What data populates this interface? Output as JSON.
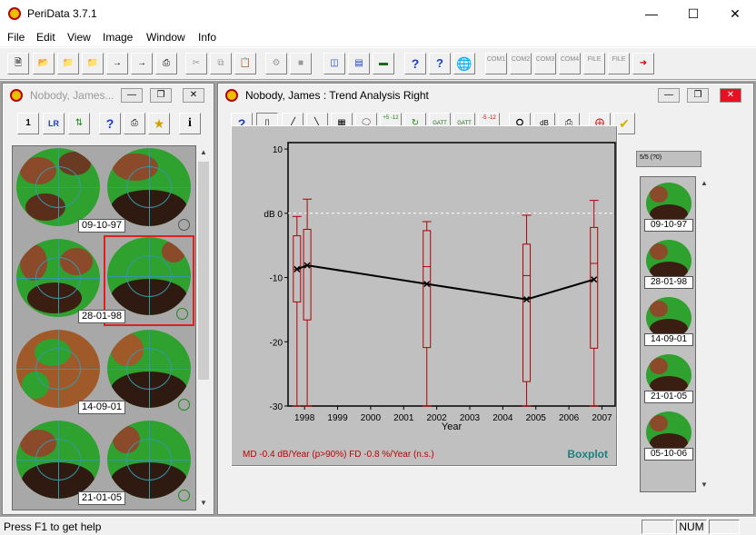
{
  "app": {
    "title": "PeriData 3.7.1"
  },
  "menu": [
    "File",
    "Edit",
    "View",
    "Image",
    "Window",
    "Info"
  ],
  "toolbar": {
    "com_labels": [
      "COM1",
      "COM2",
      "COM3",
      "COM4",
      "FILE",
      "FILE"
    ],
    "help_glyph": "?",
    "whatsthis_glyph": "?"
  },
  "left_window": {
    "title": "Nobody, James...",
    "toolbar_labels": {
      "one": "1",
      "lr": "LR",
      "help": "?",
      "info": "i"
    },
    "thumbs": [
      {
        "date": "09-10-97"
      },
      {
        "date": "28-01-98"
      },
      {
        "date": "14-09-01"
      },
      {
        "date": "21-01-05"
      }
    ]
  },
  "right_window": {
    "title": "Nobody, James  :  Trend Analysis  Right",
    "counter": "5/5 (?0)",
    "toolbar_labels": {
      "help": "?",
      "plus_minus": "+5 -12",
      "minus_plus": "-5 -12",
      "gatt": "GATT",
      "db": "dB"
    },
    "thumbs": [
      "09-10-97",
      "28-01-98",
      "14-09-01",
      "21-01-05",
      "05-10-06"
    ]
  },
  "chart_data": {
    "type": "boxplot",
    "xlabel": "Year",
    "ylabel": "dB 0",
    "x_ticks": [
      1998,
      1999,
      2000,
      2001,
      2002,
      2003,
      2004,
      2005,
      2006,
      2007
    ],
    "y_ticks": [
      10,
      0,
      -10,
      -20,
      -30
    ],
    "x_range": [
      1997.5,
      2007.4
    ],
    "y_range": [
      -30,
      11
    ],
    "boxes": [
      {
        "x": 1997.77,
        "min": -30,
        "q1": -13.8,
        "median": -8.7,
        "q3": -3.5,
        "max": -0.5
      },
      {
        "x": 1998.08,
        "min": -30,
        "q1": -16.6,
        "median": -8.1,
        "q3": -2.5,
        "max": 2.2
      },
      {
        "x": 2001.7,
        "min": -30,
        "q1": -20.9,
        "median": -8.3,
        "q3": -2.7,
        "max": -1.3
      },
      {
        "x": 2004.72,
        "min": -30,
        "q1": -26.2,
        "median": -9.7,
        "q3": -4.8,
        "max": -0.3
      },
      {
        "x": 2006.76,
        "min": -30,
        "q1": -21.0,
        "median": -7.8,
        "q3": -2.2,
        "max": 2.0
      }
    ],
    "trend": [
      {
        "x": 1997.77,
        "y": -8.7
      },
      {
        "x": 1998.08,
        "y": -8.1
      },
      {
        "x": 2001.7,
        "y": -11.0
      },
      {
        "x": 2004.72,
        "y": -13.4
      },
      {
        "x": 2006.76,
        "y": -10.3
      }
    ],
    "reference_line": 0,
    "footer_stats": "MD -0.4 dB/Year (p>90%)   FD -0.8 %/Year (n.s.)",
    "footer_label": "Boxplot"
  },
  "status": {
    "text": "Press F1 to get help",
    "num": "NUM"
  }
}
